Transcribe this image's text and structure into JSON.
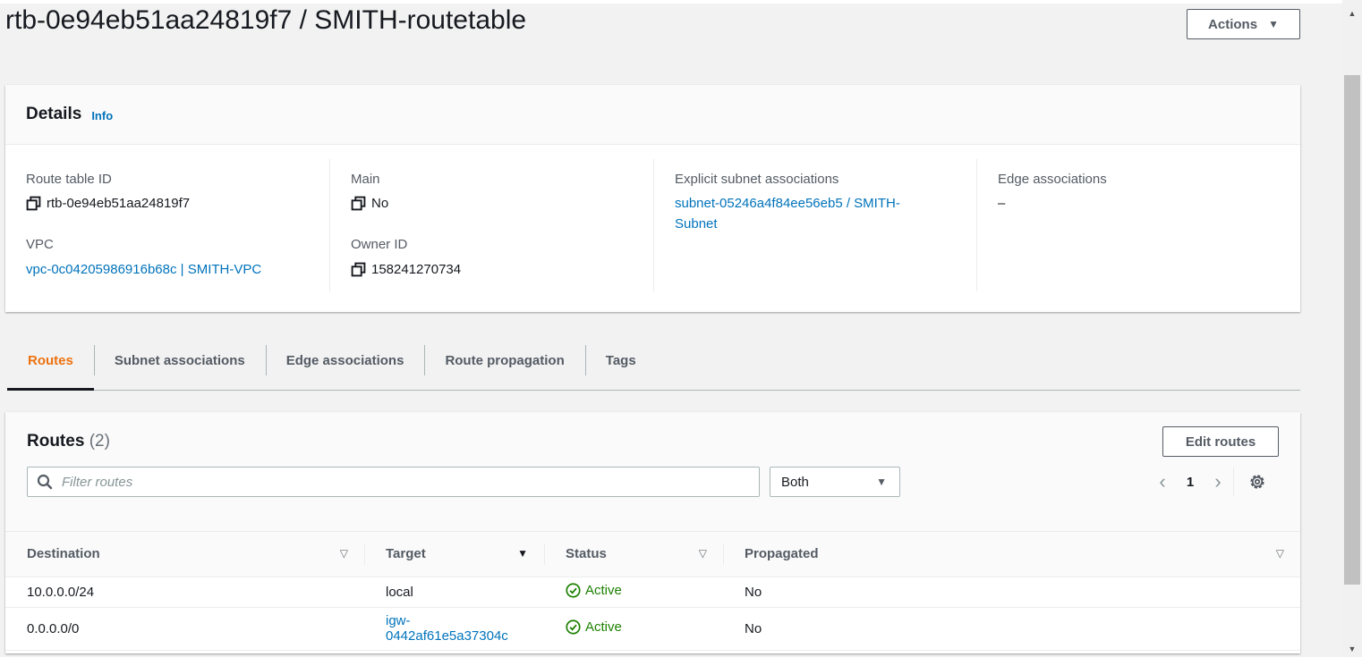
{
  "page": {
    "title": "rtb-0e94eb51aa24819f7 / SMITH-routetable",
    "actions_label": "Actions"
  },
  "details": {
    "title": "Details",
    "info": "Info",
    "route_table_id_label": "Route table ID",
    "route_table_id": "rtb-0e94eb51aa24819f7",
    "vpc_label": "VPC",
    "vpc": "vpc-0c04205986916b68c | SMITH-VPC",
    "main_label": "Main",
    "main": "No",
    "owner_id_label": "Owner ID",
    "owner_id": "158241270734",
    "explicit_label": "Explicit subnet associations",
    "explicit_line1": "subnet-05246a4f84ee56eb5 / SMITH-",
    "explicit_line2": "Subnet",
    "edge_label": "Edge associations",
    "edge": "–"
  },
  "tabs": [
    {
      "label": "Routes",
      "active": true
    },
    {
      "label": "Subnet associations",
      "active": false
    },
    {
      "label": "Edge associations",
      "active": false
    },
    {
      "label": "Route propagation",
      "active": false
    },
    {
      "label": "Tags",
      "active": false
    }
  ],
  "routes": {
    "title": "Routes",
    "count": "(2)",
    "edit_label": "Edit routes",
    "filter_placeholder": "Filter routes",
    "select_value": "Both",
    "page": "1",
    "columns": [
      "Destination",
      "Target",
      "Status",
      "Propagated"
    ],
    "rows": [
      {
        "destination": "10.0.0.0/24",
        "target_line1": "local",
        "target_line2": "",
        "status": "Active",
        "propagated": "No"
      },
      {
        "destination": "0.0.0.0/0",
        "target_line1": "igw-",
        "target_line2": "0442af61e5a37304c",
        "status": "Active",
        "propagated": "No"
      }
    ]
  },
  "colors": {
    "link": "#0073bb",
    "active_tab": "#ec7211",
    "status_ok": "#1d8102"
  }
}
